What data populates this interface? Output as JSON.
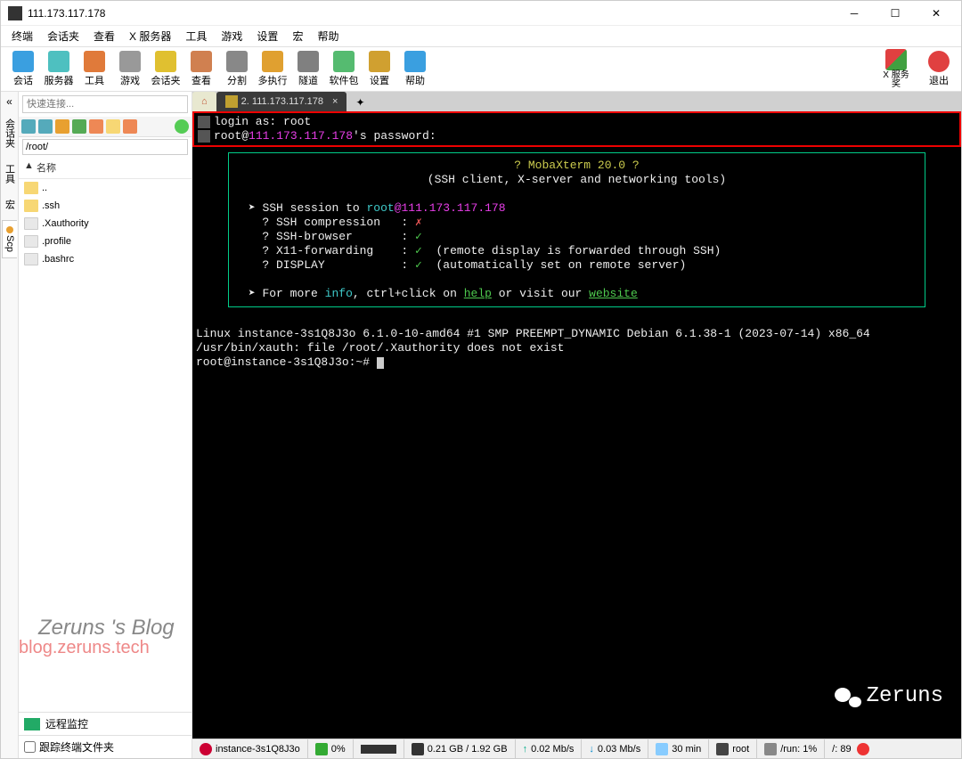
{
  "window": {
    "title": "111.173.117.178"
  },
  "menubar": [
    "终端",
    "会话夹",
    "查看",
    "X 服务器",
    "工具",
    "游戏",
    "设置",
    "宏",
    "帮助"
  ],
  "toolbar": [
    {
      "label": "会话",
      "color": "#3a9fe0"
    },
    {
      "label": "服务器",
      "color": "#4ec0c0"
    },
    {
      "label": "工具",
      "color": "#e07a3a"
    },
    {
      "label": "游戏",
      "color": "#999"
    },
    {
      "label": "会话夹",
      "color": "#e0c030"
    },
    {
      "label": "查看",
      "color": "#d08050"
    },
    {
      "label": "分割",
      "color": "#888"
    },
    {
      "label": "多执行",
      "color": "#e0a030"
    },
    {
      "label": "隧道",
      "color": "#808080"
    },
    {
      "label": "软件包",
      "color": "#55bb70"
    },
    {
      "label": "设置",
      "color": "#d0a030"
    },
    {
      "label": "帮助",
      "color": "#3a9fe0"
    }
  ],
  "toolbar_right": [
    {
      "label": "X 服务 奖",
      "label2": "",
      "color": "#e04040"
    },
    {
      "label": "退出",
      "color": "#e04040"
    }
  ],
  "quick_connect_placeholder": "快速连接...",
  "path_value": "/root/",
  "file_header": {
    "col": "▲",
    "name": "名称"
  },
  "files": [
    {
      "name": "..",
      "type": "up"
    },
    {
      "name": ".ssh",
      "type": "folder"
    },
    {
      "name": ".Xauthority",
      "type": "file"
    },
    {
      "name": ".profile",
      "type": "file"
    },
    {
      "name": ".bashrc",
      "type": "file"
    }
  ],
  "remote_monitor": "远程监控",
  "follow_terminal": "跟踪终端文件夹",
  "side_tabs": [
    "会话夹",
    "工具",
    "宏",
    "Scp"
  ],
  "tabs": {
    "home": "⌂",
    "active": "2. 111.173.117.178"
  },
  "terminal": {
    "login_as": "login as:",
    "login_user": "root",
    "pass_prefix": "root@",
    "pass_host": "111.173.117.178",
    "pass_suffix": "'s password:",
    "banner_title": "? MobaXterm 20.0 ?",
    "banner_sub": "(SSH client, X-server and networking tools)",
    "ssh_to_prefix": "SSH session to ",
    "ssh_to_user": "root",
    "ssh_to_host": "@111.173.117.178",
    "rows": [
      {
        "k": "? SSH compression",
        "v": "✗",
        "ok": false
      },
      {
        "k": "? SSH-browser",
        "v": "✓",
        "ok": true,
        "extra": ""
      },
      {
        "k": "? X11-forwarding",
        "v": "✓",
        "ok": true,
        "extra": "(remote display is forwarded through SSH)"
      },
      {
        "k": "? DISPLAY",
        "v": "✓",
        "ok": true,
        "extra": "(automatically set on remote server)"
      }
    ],
    "more_pre": "For more ",
    "more_info": "info",
    "more_mid": ", ctrl+click on ",
    "more_help": "help",
    "more_mid2": " or visit our ",
    "more_web": "website",
    "sysline": "Linux instance-3s1Q8J3o 6.1.0-10-amd64 #1 SMP PREEMPT_DYNAMIC Debian 6.1.38-1 (2023-07-14) x86_64",
    "xauth": "/usr/bin/xauth:  file /root/.Xauthority does not exist",
    "prompt": "root@instance-3s1Q8J3o:~# "
  },
  "statusbar": {
    "host": "instance-3s1Q8J3o",
    "cpu": "0%",
    "mem": "0.21 GB / 1.92 GB",
    "up": "0.02 Mb/s",
    "down": "0.03 Mb/s",
    "uptime": "30 min",
    "user": "root",
    "run": "/run: 1%",
    "disk": "/: 89"
  },
  "watermarks": {
    "blog": "Zeruns 's Blog",
    "url": "blog.zeruns.tech",
    "name": "Zeruns"
  }
}
